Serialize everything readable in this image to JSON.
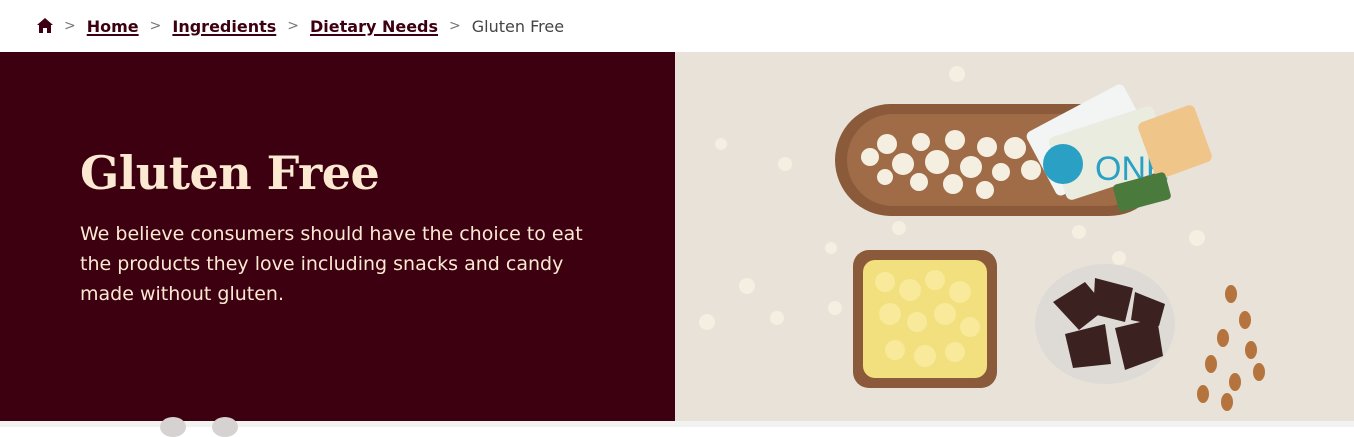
{
  "breadcrumb": {
    "home_icon": "home-icon",
    "separator": ">",
    "items": [
      {
        "label": "Home"
      },
      {
        "label": "Ingredients"
      },
      {
        "label": "Dietary Needs"
      }
    ],
    "current": "Gluten Free"
  },
  "hero": {
    "title": "Gluten Free",
    "description": "We believe consumers should have the choice to eat the products they love including snacks and candy made without gluten.",
    "image_label": "ONE",
    "colors": {
      "background": "#3d0010",
      "text": "#fbe9d2"
    }
  }
}
